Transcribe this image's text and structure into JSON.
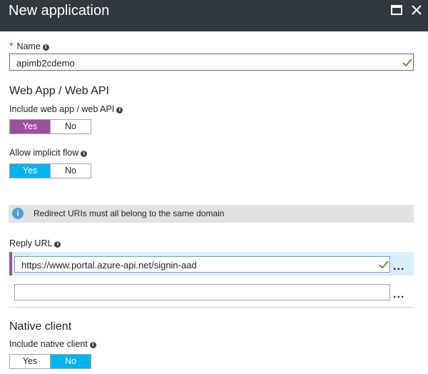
{
  "header": {
    "title": "New application",
    "maximize_icon": "maximize-icon",
    "close_icon": "close-icon"
  },
  "name": {
    "label": "Name",
    "required_marker": "*",
    "value": "apimb2cdemo"
  },
  "web_app": {
    "section_title": "Web App / Web API",
    "include": {
      "label": "Include web app / web API",
      "yes": "Yes",
      "no": "No",
      "selected": "Yes"
    },
    "implicit_flow": {
      "label": "Allow implicit flow",
      "yes": "Yes",
      "no": "No",
      "selected": "Yes"
    }
  },
  "info_bar": {
    "icon": "info-icon",
    "text": "Redirect URIs must all belong to the same domain"
  },
  "reply_url": {
    "label": "Reply URL",
    "urls": [
      "https://www.portal.azure-api.net/signin-aad",
      ""
    ],
    "more_label": "..."
  },
  "native_client": {
    "section_title": "Native client",
    "include": {
      "label": "Include native client",
      "yes": "Yes",
      "no": "No",
      "selected": "No"
    }
  },
  "colors": {
    "header_bg": "#32383f",
    "purple_accent": "#9b4f9c",
    "blue_accent": "#00b4f0",
    "valid_check": "#5aa02c",
    "info_bar_bg": "#e2e2e2"
  }
}
